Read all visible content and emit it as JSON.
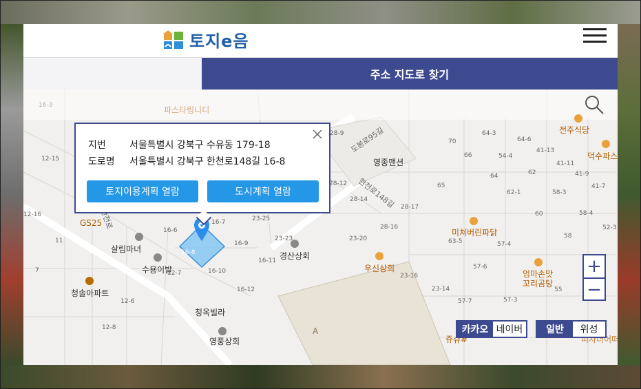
{
  "header": {
    "logo_text": "토지e음"
  },
  "tabbar": {
    "title": "주소 지도로 찾기"
  },
  "popup": {
    "jibun_label": "지번",
    "jibun_value": "서울특별시 강북구 수유동 179-18",
    "road_label": "도로명",
    "road_value": "서울특별시 강북구 한천로148길 16-8",
    "btn_land": "토지이용계획 열람",
    "btn_city": "도시계획 열람"
  },
  "map": {
    "labels": {
      "yeongjong": "영종맨션",
      "salim": "살림마녀",
      "suyoibal": "수용이발",
      "cheongsol": "청솔아파트",
      "cheongok": "청옥빌라",
      "yeongpung": "영풍상회",
      "gyeongsan": "경산상회",
      "usin": "우신상회",
      "micheo": "미쳐버린파닭",
      "eomma": "엄마손맛",
      "kkori": "꼬리곰탕",
      "jeonju": "전주식당",
      "deoksu": "덕수파스",
      "pasta": "파스타링니디",
      "gs25": "GS25",
      "jyusyu": "쥬슈#",
      "pizza": "피자더어떠",
      "A": "A"
    },
    "roads": {
      "r1": "도봉로95길",
      "r2": "한천로148길",
      "r3": "한천로"
    },
    "parcels": [
      "28-9",
      "70",
      "64-3",
      "64-6",
      "41-13",
      "66",
      "54-4",
      "41-11",
      "12-15",
      "28-12",
      "65",
      "64",
      "62",
      "41-9",
      "28-14",
      "62-1",
      "41-7",
      "28-17",
      "58-3",
      "12-16",
      "23-25",
      "16-7",
      "28-16",
      "60",
      "58-4",
      "52-3",
      "11",
      "16-6",
      "16-9",
      "23-23",
      "23-20",
      "63-5",
      "57-4",
      "58",
      "7",
      "16-11",
      "57-6",
      "16-10",
      "12-7",
      "23-16",
      "16-12",
      "12-6",
      "23-14",
      "57-7",
      "57-3",
      "55",
      "12-8",
      "16-8",
      "16-3"
    ]
  },
  "controls": {
    "zoom_in": "+",
    "zoom_out": "−",
    "kakao": "카카오",
    "naver": "네이버",
    "general": "일반",
    "satellite": "위성"
  },
  "colors": {
    "brand": "#3d4a8f",
    "button": "#2497e6",
    "selected_parcel": "#7fc4f3"
  }
}
